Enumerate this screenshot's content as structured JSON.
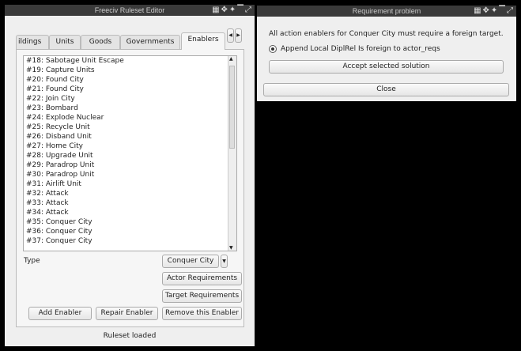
{
  "main_window": {
    "title": "Freeciv Ruleset Editor",
    "tabs": [
      "ildings",
      "Units",
      "Goods",
      "Governments",
      "Enablers"
    ],
    "enablers": [
      "#18: Sabotage Unit Escape",
      "#19: Capture Units",
      "#20: Found City",
      "#21: Found City",
      "#22: Join City",
      "#23: Bombard",
      "#24: Explode Nuclear",
      "#25: Recycle Unit",
      "#26: Disband Unit",
      "#27: Home City",
      "#28: Upgrade Unit",
      "#29: Paradrop Unit",
      "#30: Paradrop Unit",
      "#31: Airlift Unit",
      "#32: Attack",
      "#33: Attack",
      "#34: Attack",
      "#35: Conquer City",
      "#36: Conquer City",
      "#37: Conquer City"
    ],
    "type_label": "Type",
    "type_value": "Conquer City",
    "actor_req": "Actor Requirements",
    "target_req": "Target Requirements",
    "add": "Add Enabler",
    "repair": "Repair Enabler",
    "remove": "Remove this Enabler",
    "status": "Ruleset loaded"
  },
  "dialog": {
    "title": "Requirement problem",
    "message": "All action enablers for Conquer City must require a foreign target.",
    "solution": "Append Local DiplRel Is foreign to actor_reqs",
    "accept": "Accept selected solution",
    "close": "Close"
  }
}
